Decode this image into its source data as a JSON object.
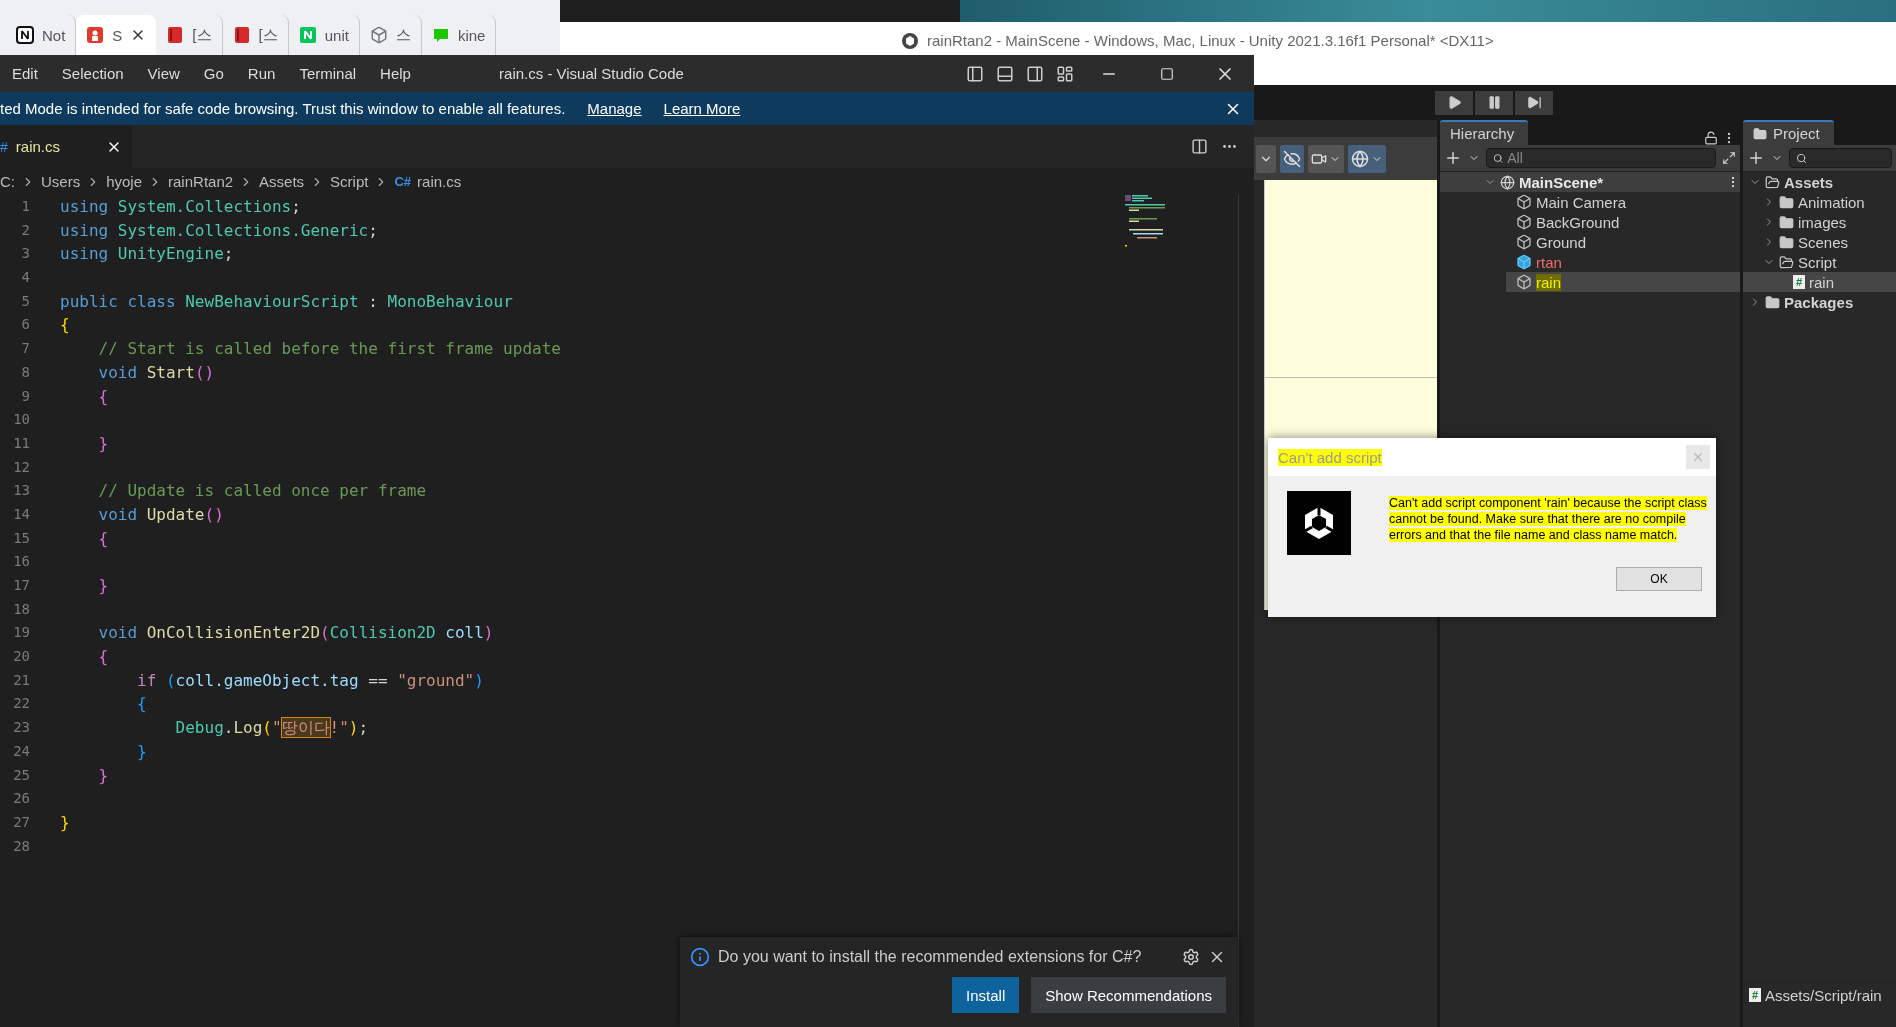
{
  "browser_tabs": [
    {
      "label": "Not",
      "kind": "notion",
      "selected": false
    },
    {
      "label": "S",
      "kind": "shield",
      "selected": true
    },
    {
      "label": "[스",
      "kind": "book",
      "selected": false
    },
    {
      "label": "[스",
      "kind": "book",
      "selected": false
    },
    {
      "label": "unit",
      "kind": "square",
      "selected": false
    },
    {
      "label": "스",
      "kind": "cube",
      "selected": false
    },
    {
      "label": "kine",
      "kind": "chat",
      "selected": false
    }
  ],
  "unity_title": "rainRtan2 - MainScene - Windows, Mac, Linux - Unity 2021.3.16f1 Personal* <DX11>",
  "vscode": {
    "menu": [
      "Edit",
      "Selection",
      "View",
      "Go",
      "Run",
      "Terminal",
      "Help"
    ],
    "title": "rain.cs - Visual Studio Code",
    "banner": {
      "text": "ted Mode is intended for safe code browsing. Trust this window to enable all features.",
      "links": [
        "Manage",
        "Learn More"
      ]
    },
    "tab": {
      "label": "rain.cs",
      "icon": "#"
    },
    "breadcrumbs": [
      {
        "label": "C:",
        "kind": "folder"
      },
      {
        "label": "Users",
        "kind": "folder"
      },
      {
        "label": "hyoje",
        "kind": "folder"
      },
      {
        "label": "rainRtan2",
        "kind": "folder"
      },
      {
        "label": "Assets",
        "kind": "folder"
      },
      {
        "label": "Script",
        "kind": "folder"
      },
      {
        "label": "rain.cs",
        "kind": "file",
        "badge": "C#"
      }
    ],
    "lines": [
      {
        "number": "1",
        "tokens": [
          {
            "kind": "keyword",
            "text": "using "
          },
          {
            "kind": "type",
            "text": "System.Collections"
          },
          {
            "kind": "plain",
            "text": ";"
          }
        ]
      },
      {
        "number": "2",
        "tokens": [
          {
            "kind": "keyword",
            "text": "using "
          },
          {
            "kind": "type",
            "text": "System.Collections.Generic"
          },
          {
            "kind": "plain",
            "text": ";"
          }
        ]
      },
      {
        "number": "3",
        "tokens": [
          {
            "kind": "keyword",
            "text": "using "
          },
          {
            "kind": "type",
            "text": "UnityEngine"
          },
          {
            "kind": "plain",
            "text": ";"
          }
        ]
      },
      {
        "number": "4"
      },
      {
        "number": "5",
        "tokens": [
          {
            "kind": "keyword",
            "text": "public class "
          },
          {
            "kind": "type",
            "text": "NewBehaviourScript"
          },
          {
            "kind": "plain",
            "text": " : "
          },
          {
            "kind": "type",
            "text": "MonoBehaviour"
          }
        ]
      },
      {
        "number": "6",
        "tokens": [
          {
            "kind": "brace1",
            "text": "{"
          }
        ]
      },
      {
        "number": "7",
        "tokens": [
          {
            "kind": "comment",
            "text": "    // Start is called before the first frame update"
          }
        ]
      },
      {
        "number": "8",
        "tokens": [
          {
            "kind": "keyword",
            "text": "    void "
          },
          {
            "kind": "function",
            "text": "Start"
          },
          {
            "kind": "brace2",
            "text": "()"
          }
        ]
      },
      {
        "number": "9",
        "tokens": [
          {
            "kind": "brace2",
            "text": "    {"
          }
        ]
      },
      {
        "number": "10"
      },
      {
        "number": "11",
        "tokens": [
          {
            "kind": "brace2",
            "text": "    }"
          }
        ]
      },
      {
        "number": "12"
      },
      {
        "number": "13",
        "tokens": [
          {
            "kind": "comment",
            "text": "    // Update is called once per frame"
          }
        ]
      },
      {
        "number": "14",
        "tokens": [
          {
            "kind": "keyword",
            "text": "    void "
          },
          {
            "kind": "function",
            "text": "Update"
          },
          {
            "kind": "brace2",
            "text": "()"
          }
        ]
      },
      {
        "number": "15",
        "tokens": [
          {
            "kind": "brace2",
            "text": "    {"
          }
        ]
      },
      {
        "number": "16"
      },
      {
        "number": "17",
        "tokens": [
          {
            "kind": "brace2",
            "text": "    }"
          }
        ]
      },
      {
        "number": "18"
      },
      {
        "number": "19",
        "tokens": [
          {
            "kind": "keyword",
            "text": "    void "
          },
          {
            "kind": "function",
            "text": "OnCollisionEnter2D"
          },
          {
            "kind": "brace2",
            "text": "("
          },
          {
            "kind": "type",
            "text": "Collision2D "
          },
          {
            "kind": "variable",
            "text": "coll"
          },
          {
            "kind": "brace2",
            "text": ")"
          }
        ]
      },
      {
        "number": "20",
        "tokens": [
          {
            "kind": "brace2",
            "text": "    {"
          }
        ]
      },
      {
        "number": "21",
        "tokens": [
          {
            "kind": "control",
            "text": "        if "
          },
          {
            "kind": "brace3",
            "text": "("
          },
          {
            "kind": "variable",
            "text": "coll.gameObject.tag"
          },
          {
            "kind": "plain",
            "text": " == "
          },
          {
            "kind": "string",
            "text": "\"ground\""
          },
          {
            "kind": "brace3",
            "text": ")"
          }
        ]
      },
      {
        "number": "22",
        "tokens": [
          {
            "kind": "brace3",
            "text": "        {"
          }
        ]
      },
      {
        "number": "23",
        "tokens": [
          {
            "kind": "type",
            "text": "            Debug"
          },
          {
            "kind": "plain",
            "text": "."
          },
          {
            "kind": "function",
            "text": "Log"
          },
          {
            "kind": "brace1",
            "text": "("
          },
          {
            "kind": "string",
            "text": "\""
          },
          {
            "kind": "match",
            "text": "땅이다"
          },
          {
            "kind": "string",
            "text": "!\""
          },
          {
            "kind": "brace1",
            "text": ")"
          },
          {
            "kind": "plain",
            "text": ";"
          }
        ]
      },
      {
        "number": "24",
        "tokens": [
          {
            "kind": "brace3",
            "text": "        }"
          }
        ]
      },
      {
        "number": "25",
        "tokens": [
          {
            "kind": "brace2",
            "text": "    }"
          }
        ]
      },
      {
        "number": "26"
      },
      {
        "number": "27",
        "tokens": [
          {
            "kind": "brace1",
            "text": "}"
          }
        ]
      },
      {
        "number": "28"
      }
    ],
    "notification": {
      "text": "Do you want to install the recommended extensions for C#?",
      "buttons": [
        {
          "label": "Install",
          "primary": true
        },
        {
          "label": "Show Recommendations",
          "primary": false
        }
      ]
    }
  },
  "unity": {
    "hierarchy": {
      "title": "Hierarchy",
      "search_placeholder": "All",
      "scene": "MainScene*",
      "items": [
        {
          "label": "Main Camera",
          "kind": "object",
          "selected": false,
          "highlighted": false
        },
        {
          "label": "BackGround",
          "kind": "object",
          "selected": false,
          "highlighted": false
        },
        {
          "label": "Ground",
          "kind": "object",
          "selected": false,
          "highlighted": false
        },
        {
          "label": "rtan",
          "kind": "prefab",
          "selected": false,
          "highlighted": false
        },
        {
          "label": "rain",
          "kind": "object",
          "selected": true,
          "highlighted": true
        }
      ]
    },
    "project": {
      "title": "Project",
      "tree": [
        {
          "label": "Assets",
          "kind": "folder",
          "expanded": true,
          "selected": false,
          "children": [
            {
              "label": "Animation",
              "kind": "folder",
              "expanded": false,
              "selected": false
            },
            {
              "label": "images",
              "kind": "folder",
              "expanded": false,
              "selected": false
            },
            {
              "label": "Scenes",
              "kind": "folder",
              "expanded": false,
              "selected": false
            },
            {
              "label": "Script",
              "kind": "folder",
              "expanded": true,
              "selected": false,
              "children": [
                {
                  "label": "rain",
                  "kind": "script",
                  "selected": true
                }
              ]
            }
          ]
        },
        {
          "label": "Packages",
          "kind": "folder",
          "expanded": false,
          "selected": false
        }
      ],
      "path": "Assets/Script/rain"
    },
    "dialog": {
      "title": "Can't add script",
      "message": "Can't add script component 'rain' because the script class cannot be found. Make sure that there are no compile errors and that the file name and class name match.",
      "button": "OK",
      "highlighted": true
    }
  }
}
